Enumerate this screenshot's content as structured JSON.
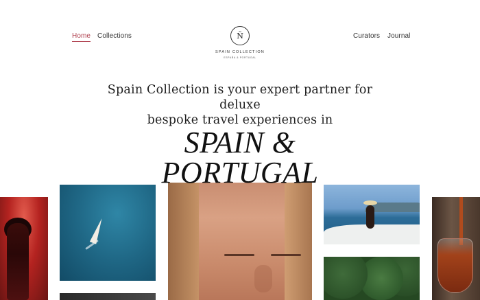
{
  "nav": {
    "left": [
      "Home",
      "Collections"
    ],
    "right": [
      "Curators",
      "Journal"
    ],
    "active": "Home",
    "active_color": "#b0414f"
  },
  "logo": {
    "mark": "Ñ",
    "name": "SPAIN COLLECTION",
    "subtitle": "ESPAÑA & PORTUGAL"
  },
  "intro": {
    "line1": "Spain Collection is your expert partner for deluxe",
    "line2": "bespoke travel experiences in"
  },
  "headline": {
    "line1": "SPAIN &",
    "line2": "PORTUGAL"
  },
  "gallery": [
    {
      "name": "woman-red-dress-photo"
    },
    {
      "name": "sailboat-sea-photo"
    },
    {
      "name": "woman-face-closeup-photo"
    },
    {
      "name": "woman-on-yacht-photo"
    },
    {
      "name": "forest-aerial-photo"
    },
    {
      "name": "wine-glass-pour-photo"
    }
  ]
}
